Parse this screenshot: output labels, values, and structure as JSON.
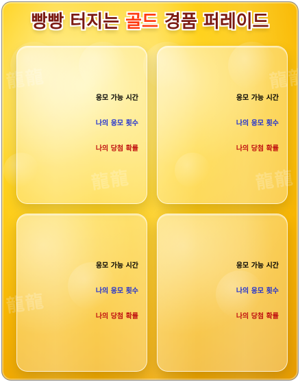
{
  "title": {
    "part1": "빵빵 터지는 ",
    "accent": "골드",
    "part2": " 경품 퍼레이드"
  },
  "cards": [
    {
      "time_label": "응모 가능 시간",
      "count_label": "나의 응모 횟수",
      "prob_label": "나의 당첨 확률"
    },
    {
      "time_label": "응모 가능 시간",
      "count_label": "나의 응모 횟수",
      "prob_label": "나의 당첨 확률"
    },
    {
      "time_label": "응모 가능 시간",
      "count_label": "나의 응모 횟수",
      "prob_label": "나의 당첨 확률"
    },
    {
      "time_label": "응모 가능 시간",
      "count_label": "나의 응모 횟수",
      "prob_label": "나의 당첨 확률"
    }
  ],
  "colors": {
    "title_dark": "#7b1a12",
    "title_accent": "#ff3b12",
    "time_text": "#000000",
    "count_text": "#2030d0",
    "prob_text": "#c01010",
    "frame_border": "#8a8a8a"
  }
}
